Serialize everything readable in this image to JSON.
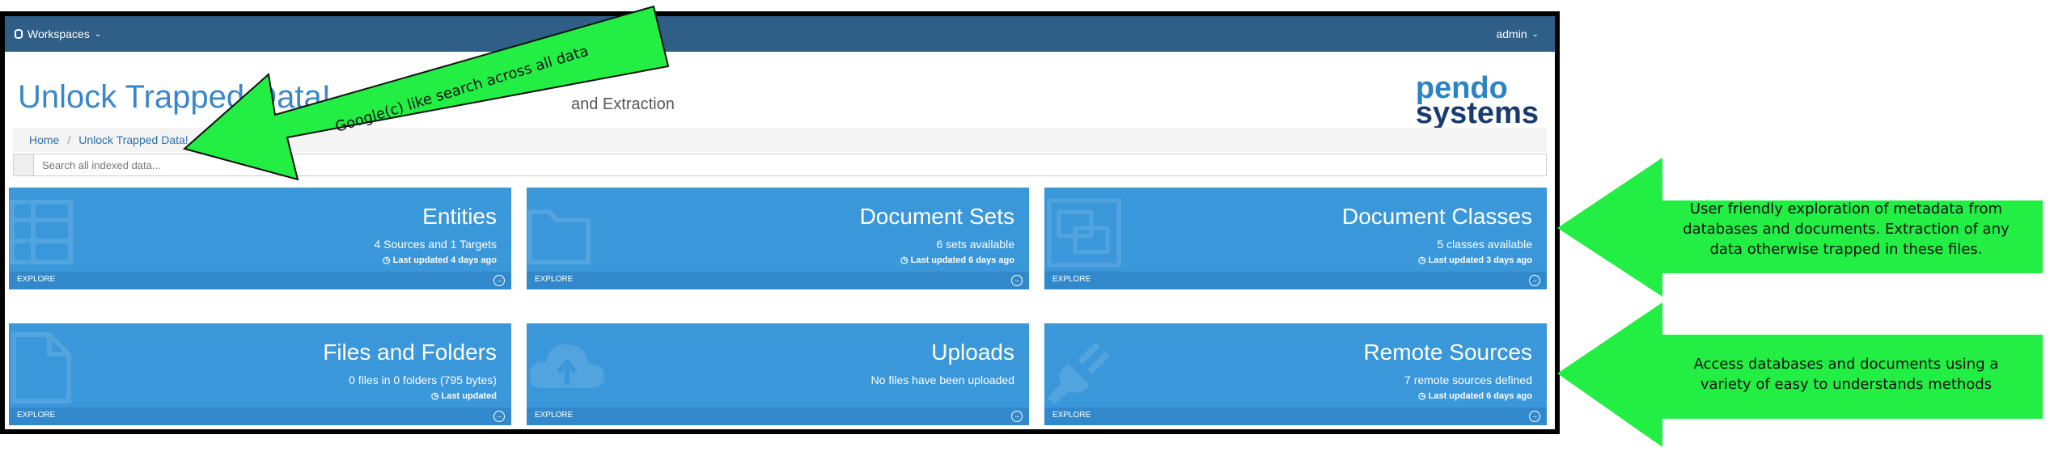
{
  "navbar": {
    "workspaces_label": "Workspaces",
    "user_label": "admin"
  },
  "header": {
    "title": "Unlock Trapped Data!",
    "subtitle": "and Extraction"
  },
  "logo": {
    "line1": "pendo",
    "line2": "systems"
  },
  "breadcrumb": {
    "home": "Home",
    "current": "Unlock Trapped Data!"
  },
  "search": {
    "placeholder": "Search all indexed data..."
  },
  "tiles": [
    {
      "title": "Entities",
      "subtitle": "4 Sources and 1 Targets",
      "updated": "◷ Last updated 4 days ago",
      "explore": "EXPLORE",
      "icon": "table-icon"
    },
    {
      "title": "Document Sets",
      "subtitle": "6 sets available",
      "updated": "◷ Last updated 6 days ago",
      "explore": "EXPLORE",
      "icon": "folder-icon"
    },
    {
      "title": "Document Classes",
      "subtitle": "5 classes available",
      "updated": "◷ Last updated 3 days ago",
      "explore": "EXPLORE",
      "icon": "object-group-icon"
    },
    {
      "title": "Files and Folders",
      "subtitle": "0 files in 0 folders (795 bytes)",
      "updated": "◷ Last updated",
      "explore": "EXPLORE",
      "icon": "file-icon"
    },
    {
      "title": "Uploads",
      "subtitle": "No files have been uploaded",
      "updated": "",
      "explore": "EXPLORE",
      "icon": "cloud-upload-icon"
    },
    {
      "title": "Remote Sources",
      "subtitle": "7 remote sources defined",
      "updated": "◷ Last updated 6 days ago",
      "explore": "EXPLORE",
      "icon": "plug-icon"
    }
  ],
  "annotations": {
    "search_arrow_text": "Google(c) like search across all data",
    "callout_top": "User friendly exploration of metadata from databases and documents.  Extraction of any data otherwise trapped in these files.",
    "callout_bottom": "Access databases and documents using a variety of easy to understands methods",
    "arrow_color": "#22ee44"
  }
}
